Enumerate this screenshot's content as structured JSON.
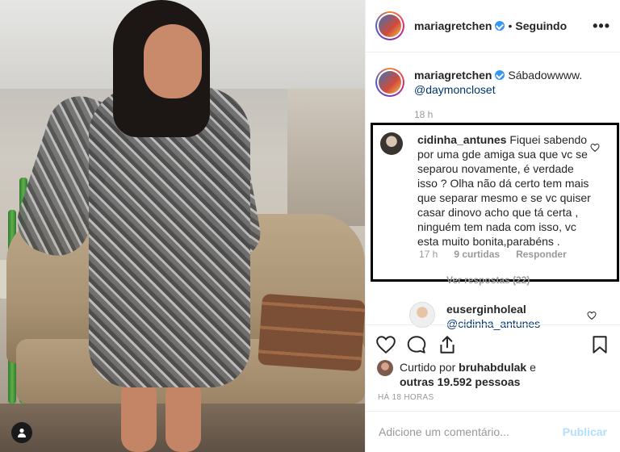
{
  "post": {
    "username": "mariagretchen",
    "separator": "•",
    "follow_status": "Seguindo",
    "more_label": "•••"
  },
  "caption": {
    "username": "mariagretchen",
    "text": "Sábadowwww.",
    "mention": "@daymoncloset",
    "time": "18 h"
  },
  "comments": [
    {
      "username": "cidinha_antunes",
      "text": "Fiquei sabendo por uma gde amiga sua que vc se separou novamente, é verdade isso ? Olha não dá certo tem mais que separar mesmo e se vc quiser casar dinovo acho que tá certa , ninguém tem nada com isso, vc esta muito bonita,parabéns .",
      "time": "17 h",
      "likes": "9 curtidas",
      "reply": "Responder"
    },
    {
      "username": "euserginholeal",
      "text": "@cidinha_antunes"
    }
  ],
  "view_replies": "Ver respostas (22)",
  "likes": {
    "prefix": "Curtido por",
    "first_user": "bruhabdulak",
    "connector": "e",
    "others": "outras 19.592 pessoas"
  },
  "posted_ago": "HÁ 18 HORAS",
  "add_comment": {
    "placeholder": "Adicione um comentário...",
    "publish": "Publicar"
  },
  "icons": {
    "like": "heart-icon",
    "comment": "comment-icon",
    "share": "share-icon",
    "save": "bookmark-icon",
    "tag": "user-tag-icon"
  },
  "colors": {
    "verified": "#3897f0",
    "link": "#003569",
    "muted": "#999999",
    "publish_disabled": "#b2dffc"
  }
}
